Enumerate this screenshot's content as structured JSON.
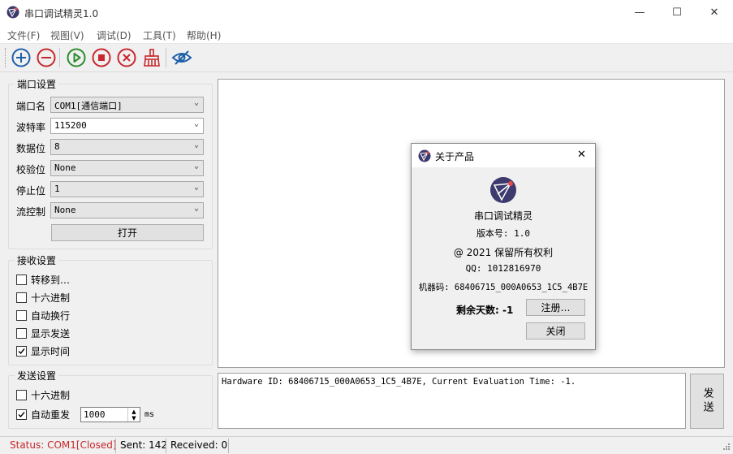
{
  "window": {
    "title": "串口调试精灵1.0",
    "controls": {
      "minimize": "—",
      "maximize": "☐",
      "close": "✕"
    }
  },
  "menu": [
    "文件(F)",
    "视图(V)",
    "调试(D)",
    "工具(T)",
    "帮助(H)"
  ],
  "toolbar": {
    "icons": [
      "add-icon",
      "remove-icon",
      "play-icon",
      "stop-icon",
      "cancel-icon",
      "broom-icon",
      "eye-icon"
    ],
    "colors": {
      "blue": "#1f5fa8",
      "red": "#c8282d",
      "green": "#2e8b2e"
    }
  },
  "port_settings": {
    "title": "端口设置",
    "port_name": {
      "label": "端口名",
      "value": "COM1[通信端口]"
    },
    "baud_rate": {
      "label": "波特率",
      "value": "115200"
    },
    "data_bits": {
      "label": "数据位",
      "value": "8"
    },
    "parity": {
      "label": "校验位",
      "value": "None"
    },
    "stop_bits": {
      "label": "停止位",
      "value": "1"
    },
    "flow_control": {
      "label": "流控制",
      "value": "None"
    },
    "open_button": "打开"
  },
  "receive_settings": {
    "title": "接收设置",
    "options": [
      {
        "label": "转移到…",
        "checked": false
      },
      {
        "label": "十六进制",
        "checked": false
      },
      {
        "label": "自动换行",
        "checked": false
      },
      {
        "label": "显示发送",
        "checked": false
      },
      {
        "label": "显示时间",
        "checked": true
      }
    ]
  },
  "send_settings": {
    "title": "发送设置",
    "hex": {
      "label": "十六进制",
      "checked": false
    },
    "auto_resend": {
      "label": "自动重发",
      "checked": true
    },
    "interval": {
      "value": "1000",
      "unit": "ms"
    }
  },
  "send_pane": {
    "text": "Hardware ID: 68406715_000A0653_1C5_4B7E, Current Evaluation Time: -1.",
    "send_button": "发送"
  },
  "status_bar": {
    "status": "Status: COM1[Closed]",
    "status_color": "#c8282d",
    "sent": "Sent: 142",
    "received": "Received: 0"
  },
  "about_dialog": {
    "title": "关于产品",
    "product_name": "串口调试精灵",
    "version": "版本号: 1.0",
    "copyright": "@ 2021 保留所有权利",
    "qq": "QQ: 1012816970",
    "machine_code": "机器码: 68406715_000A0653_1C5_4B7E",
    "remaining_days_label": "剩余天数: -1",
    "register_button": "注册…",
    "close_button": "关闭",
    "close_icon": "✕"
  }
}
